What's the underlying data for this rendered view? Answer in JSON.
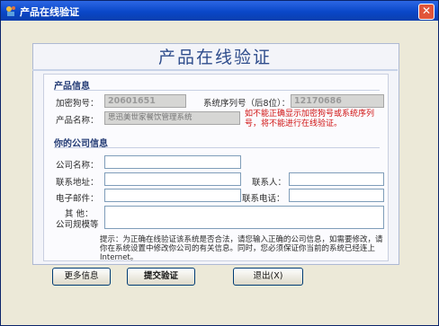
{
  "window": {
    "title": "产品在线验证",
    "close_glyph": "✕"
  },
  "heading": "产品在线验证",
  "product_section": {
    "label": "产品信息",
    "encryption_code_label": "加密狗号：",
    "encryption_code_value": "20601651",
    "serial_label": "系统序列号（后8位）：",
    "serial_value": "12170686",
    "product_name_label": "产品名称：",
    "product_name_value": "思迅美世家餐饮管理系统",
    "warning": "如不能正确显示加密狗号或系统序列号，将不能进行在线验证。"
  },
  "company_section": {
    "label": "你的公司信息",
    "company_name_label": "公司名称：",
    "address_label": "联系地址：",
    "contact_label": "联系人：",
    "email_label": "电子邮件：",
    "phone_label": "联系电话：",
    "other_label_line1": "其    他：",
    "other_label_line2": "公司规模等"
  },
  "note": "提示：为正确在线验证该系统是否合法，请您输入正确的公司信息，如需要修改，请你在系统设置中修改你公司的有关信息。同时，您必须保证你当前的系统已经连上Internet。",
  "buttons": {
    "more_info": "更多信息",
    "submit": "提交验证",
    "exit": "退出(X)"
  },
  "colors": {
    "titlebar": "#0a47c8",
    "heading": "#2f4d8c",
    "warning": "#d01010"
  }
}
